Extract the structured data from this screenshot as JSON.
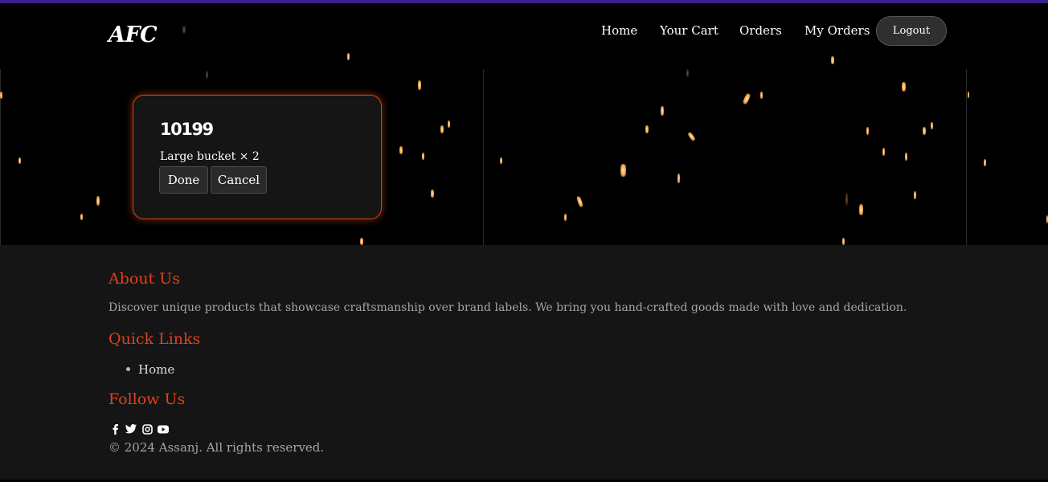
{
  "navbar": {
    "logo": "AFC",
    "links": [
      "Home",
      "Your Cart",
      "Orders",
      "My Orders"
    ],
    "logout_label": "Logout"
  },
  "order_card": {
    "order_id": "10199",
    "item_line": "Large bucket × 2",
    "done_label": "Done",
    "cancel_label": "Cancel"
  },
  "footer": {
    "about_heading": "About Us",
    "about_text": "Discover unique products that showcase craftsmanship over brand labels. We bring you hand-crafted goods made with love and dedication.",
    "quick_links_heading": "Quick Links",
    "quick_links": [
      "Home"
    ],
    "follow_heading": "Follow Us",
    "social_icons": [
      "facebook-icon",
      "twitter-icon",
      "instagram-icon",
      "youtube-icon"
    ],
    "copyright": "© 2024 Assanj. All rights reserved."
  },
  "colors": {
    "accent": "#e2401a",
    "card_border": "#d8421a",
    "footer_bg": "#151515",
    "top_bar": "#3b1f8f"
  }
}
